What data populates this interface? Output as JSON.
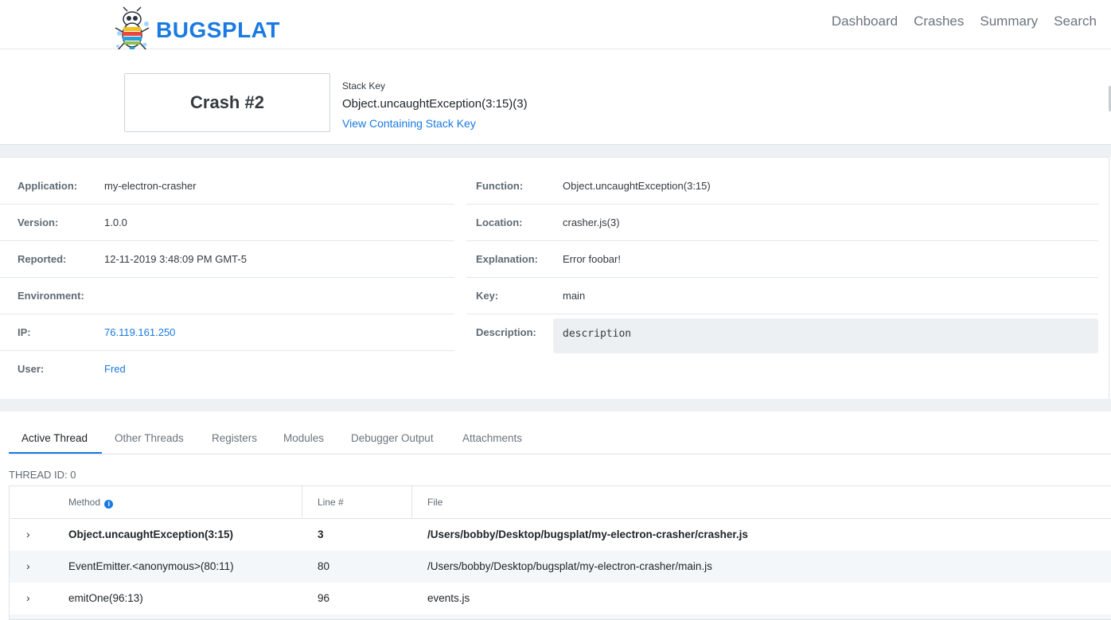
{
  "nav": {
    "logo_text": "BUGSPLAT",
    "links": [
      "Dashboard",
      "Crashes",
      "Summary",
      "Search"
    ]
  },
  "crash": {
    "title": "Crash #2",
    "stack_key_label": "Stack Key",
    "stack_key_value": "Object.uncaughtException(3:15)(3)",
    "stack_key_link": "View Containing Stack Key"
  },
  "details": {
    "left": [
      {
        "label": "Application:",
        "value": "my-electron-crasher"
      },
      {
        "label": "Version:",
        "value": "1.0.0"
      },
      {
        "label": "Reported:",
        "value": "12-11-2019 3:48:09 PM GMT-5"
      },
      {
        "label": "Environment:",
        "value": ""
      },
      {
        "label": "IP:",
        "value": "76.119.161.250"
      },
      {
        "label": "User:",
        "value": "Fred"
      }
    ],
    "right": [
      {
        "label": "Function:",
        "value": "Object.uncaughtException(3:15)"
      },
      {
        "label": "Location:",
        "value": "crasher.js(3)"
      },
      {
        "label": "Explanation:",
        "value": "Error foobar!"
      },
      {
        "label": "Key:",
        "value": "main"
      },
      {
        "label": "Description:",
        "value": "description"
      }
    ]
  },
  "tabs": [
    "Active Thread",
    "Other Threads",
    "Registers",
    "Modules",
    "Debugger Output",
    "Attachments"
  ],
  "thread_id": "THREAD ID: 0",
  "table": {
    "headers": [
      "Method",
      "Line #",
      "File"
    ],
    "rows": [
      {
        "method": "Object.uncaughtException(3:15)",
        "line": "3",
        "file": "/Users/bobby/Desktop/bugsplat/my-electron-crasher/crasher.js"
      },
      {
        "method": "EventEmitter.<anonymous>(80:11)",
        "line": "80",
        "file": "/Users/bobby/Desktop/bugsplat/my-electron-crasher/main.js"
      },
      {
        "method": "emitOne(96:13)",
        "line": "96",
        "file": "events.js"
      }
    ]
  },
  "colors": {
    "accent": "#1a7ae2",
    "band": "#eef1f3",
    "row_alt": "#f4f7fa"
  },
  "icons": {
    "chevron": "›",
    "info": "i"
  }
}
